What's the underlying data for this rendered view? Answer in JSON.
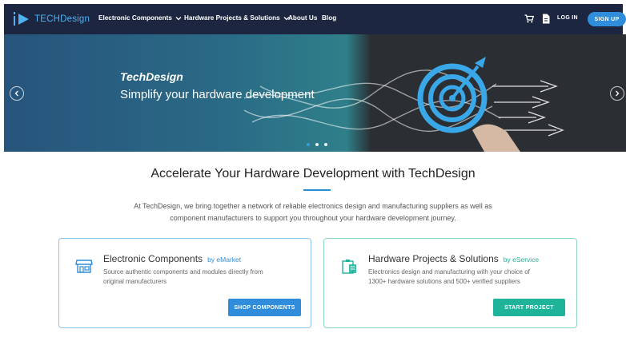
{
  "colors": {
    "nav_bg": "#1c2640",
    "brand_blue": "#2f8ddb",
    "brand_teal": "#1fb39a",
    "logo_text": "#4fb1f0"
  },
  "nav": {
    "logo_text": "TECHDesign",
    "items": [
      {
        "label": "Electronic Components",
        "dropdown": true
      },
      {
        "label": "Hardware Projects & Solutions",
        "dropdown": true
      },
      {
        "label": "About Us",
        "dropdown": false
      },
      {
        "label": "Blog",
        "dropdown": false
      }
    ],
    "icons": [
      "cart-icon",
      "document-icon"
    ],
    "login_label": "LOG IN",
    "signup_label": "SIGN UP"
  },
  "hero": {
    "title": "TechDesign",
    "subtitle": "Simplify your hardware development",
    "slide_count": 3,
    "active_slide": 1
  },
  "main": {
    "headline": "Accelerate Your Hardware Development with TechDesign",
    "intro_line1": "At TechDesign, we bring together a network of reliable electronics design and manufacturing suppliers as well as",
    "intro_line2": "component manufacturers to support you throughout your hardware development journey."
  },
  "cards": [
    {
      "title": "Electronic Components",
      "by": "by eMarket",
      "desc_line1": "Source authentic components and modules directly from",
      "desc_line2": "original manufacturers",
      "button": "SHOP COMPONENTS",
      "icon": "store-icon",
      "accent": "#2f8ddb"
    },
    {
      "title": "Hardware Projects & Solutions",
      "by": "by eService",
      "desc_line1": "Electronics design and manufacturing with your choice of",
      "desc_line2": "1300+ hardware solutions and 500+ verified suppliers",
      "button": "START PROJECT",
      "icon": "clipboard-icon",
      "accent": "#1fb39a"
    }
  ]
}
